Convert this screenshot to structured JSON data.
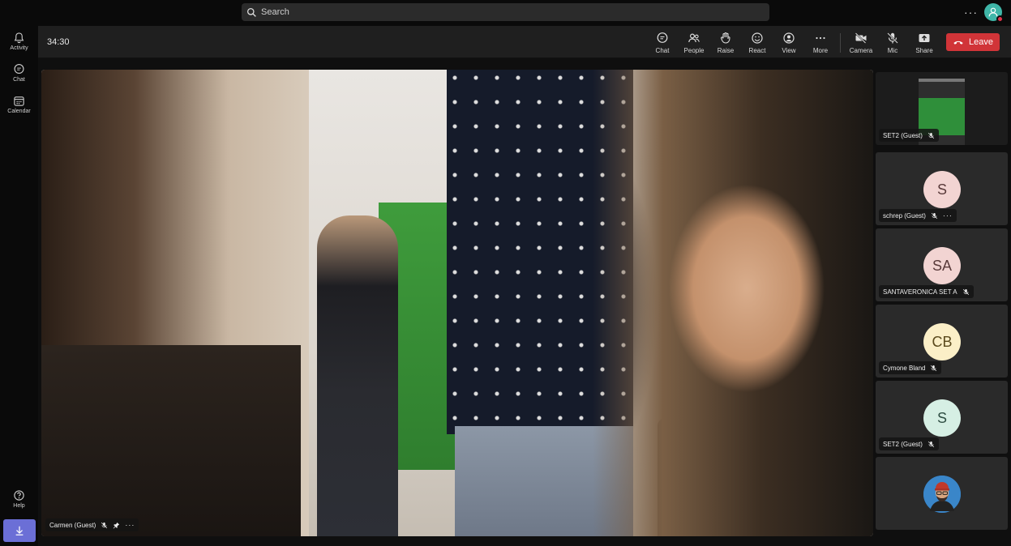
{
  "search": {
    "placeholder": "Search"
  },
  "rail": {
    "items": [
      {
        "label": "Activity",
        "icon": "bell-icon"
      },
      {
        "label": "Chat",
        "icon": "chat-icon"
      },
      {
        "label": "Calendar",
        "icon": "calendar-icon"
      }
    ],
    "help": "Help"
  },
  "meeting": {
    "timer": "34:30",
    "actions": [
      {
        "label": "Chat",
        "icon": "chat-icon"
      },
      {
        "label": "People",
        "icon": "people-icon"
      },
      {
        "label": "Raise",
        "icon": "hand-icon"
      },
      {
        "label": "React",
        "icon": "smile-icon"
      },
      {
        "label": "View",
        "icon": "view-icon"
      },
      {
        "label": "More",
        "icon": "more-icon"
      },
      {
        "label": "Camera",
        "icon": "camera-off-icon"
      },
      {
        "label": "Mic",
        "icon": "mic-off-icon"
      },
      {
        "label": "Share",
        "icon": "share-icon"
      }
    ],
    "leave": "Leave"
  },
  "main_video": {
    "name": "Carmen (Guest)"
  },
  "participants": [
    {
      "name": "SET2 (Guest)",
      "initials": "",
      "type": "screen"
    },
    {
      "name": "schrep (Guest)",
      "initials": "S",
      "color": "#f2d4d2",
      "text_color": "#5a3b3b"
    },
    {
      "name": "SANTAVERONICA SET A",
      "initials": "SA",
      "color": "#f2d4d2",
      "text_color": "#5a3b3b"
    },
    {
      "name": "Cymone Bland",
      "initials": "CB",
      "color": "#fbefc7",
      "text_color": "#5b4a1d"
    },
    {
      "name": "SET2 (Guest)",
      "initials": "S",
      "color": "#d6efe4",
      "text_color": "#2f4e43"
    },
    {
      "name": "",
      "initials": "",
      "type": "photo"
    }
  ]
}
